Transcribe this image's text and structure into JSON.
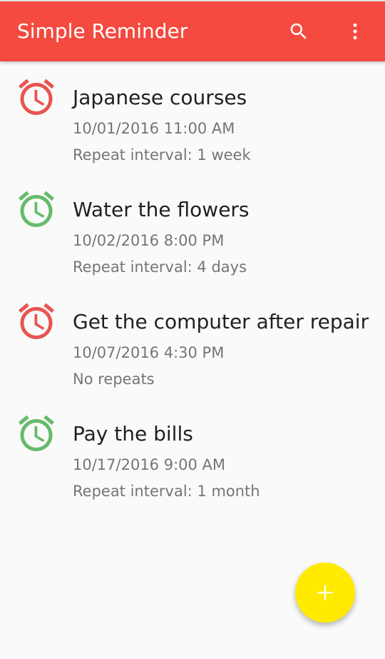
{
  "app": {
    "title": "Simple Reminder"
  },
  "toolbar": {
    "search_icon": "search-icon",
    "more_icon": "more-vert-icon"
  },
  "colors": {
    "appbar": "#f44a3f",
    "alarm_active": "#e8544f",
    "alarm_inactive": "#66bb6a",
    "fab": "#ffea00"
  },
  "reminders": [
    {
      "title": "Japanese courses",
      "datetime": "10/01/2016 11:00 AM",
      "repeat": "Repeat interval: 1 week",
      "icon": "alarm-clock-icon",
      "icon_color": "#e8544f"
    },
    {
      "title": "Water the flowers",
      "datetime": "10/02/2016 8:00 PM",
      "repeat": "Repeat interval: 4 days",
      "icon": "alarm-clock-icon",
      "icon_color": "#66bb6a"
    },
    {
      "title": "Get the computer after repair",
      "datetime": "10/07/2016 4:30 PM",
      "repeat": "No repeats",
      "icon": "alarm-clock-icon",
      "icon_color": "#e8544f"
    },
    {
      "title": "Pay the bills",
      "datetime": "10/17/2016 9:00 AM",
      "repeat": "Repeat interval: 1 month",
      "icon": "alarm-clock-icon",
      "icon_color": "#66bb6a"
    }
  ],
  "fab": {
    "icon": "plus-icon"
  }
}
